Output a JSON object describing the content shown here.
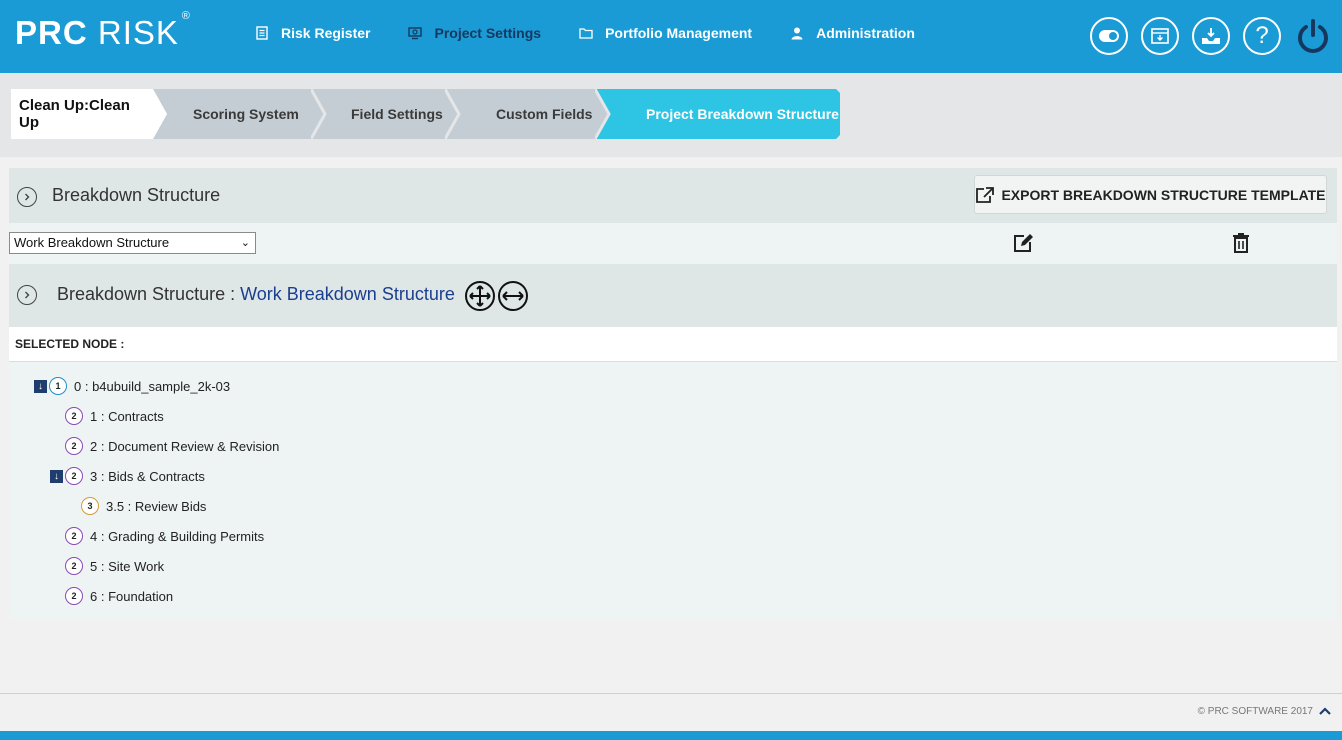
{
  "brand": {
    "name_bold": "PRC",
    "name_light": " RISK",
    "registered": "®"
  },
  "nav": [
    {
      "label": "Risk Register",
      "icon": "list-icon"
    },
    {
      "label": "Project Settings",
      "icon": "settings-monitor-icon"
    },
    {
      "label": "Portfolio Management",
      "icon": "folder-icon"
    },
    {
      "label": "Administration",
      "icon": "user-icon"
    }
  ],
  "top_icons": [
    "toggle-icon",
    "calendar-icon",
    "inbox-download-icon",
    "help-icon",
    "power-icon"
  ],
  "help_glyph": "?",
  "wizard": {
    "project": "Clean Up:Clean Up",
    "steps": [
      "Scoring System",
      "Field Settings",
      "Custom Fields",
      "Project Breakdown Structure"
    ]
  },
  "breakdown_panel": {
    "title": "Breakdown Structure",
    "export_label": "EXPORT BREAKDOWN STRUCTURE TEMPLATE"
  },
  "structure_select": {
    "value": "Work Breakdown Structure",
    "caret": "⌄"
  },
  "structure_panel": {
    "title_prefix": "Breakdown Structure : ",
    "title_value": "Work Breakdown Structure"
  },
  "selected_node_label": "SELECTED NODE :",
  "tree": [
    {
      "level": "1",
      "label": "0 : b4ubuild_sample_2k-03",
      "expandable": true
    },
    {
      "level": "2",
      "label": "1 : Contracts",
      "expandable": false
    },
    {
      "level": "2",
      "label": "2 : Document Review & Revision",
      "expandable": false
    },
    {
      "level": "2",
      "label": "3 : Bids & Contracts",
      "expandable": true
    },
    {
      "level": "3",
      "label": "3.5 : Review Bids",
      "expandable": false
    },
    {
      "level": "2",
      "label": "4 : Grading & Building Permits",
      "expandable": false
    },
    {
      "level": "2",
      "label": "5 : Site Work",
      "expandable": false
    },
    {
      "level": "2",
      "label": "6 : Foundation",
      "expandable": false
    }
  ],
  "footer": {
    "copyright": "© PRC SOFTWARE 2017"
  },
  "colors": {
    "primary": "#1a9bd5",
    "active_step": "#2ec4e4",
    "navy": "#1f3d6d"
  }
}
